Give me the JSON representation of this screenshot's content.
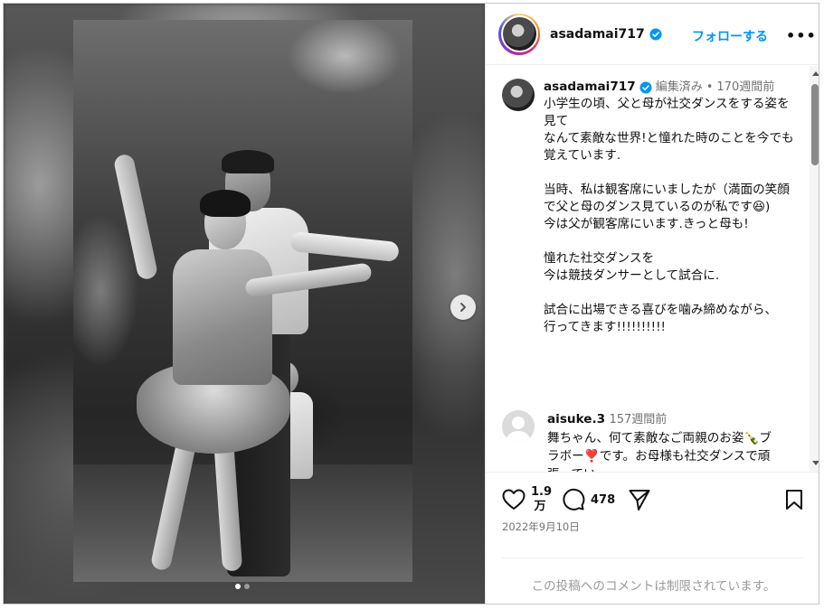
{
  "post": {
    "author": {
      "username": "asadamai717",
      "verified": true,
      "verified_icon": "verified-badge-icon",
      "verified_color": "#0095f6"
    },
    "follow_label": "フォローする",
    "more_icon": "more-horizontal-icon",
    "more_label": "•••"
  },
  "media": {
    "carousel_dots": 2,
    "active_dot": 0,
    "next_icon": "chevron-right-icon"
  },
  "caption": {
    "username": "asadamai717",
    "edited_label": "編集済み",
    "separator": "•",
    "time": "170週間前",
    "lines": [
      "小学生の頃、父と母が社交ダンスをする姿を見て",
      "なんて素敵な世界!と憧れた時のことを今でも覚えています.",
      "",
      "当時、私は観客席にいましたが（満面の笑顔で父と母のダンス見ているのが私です😆)",
      "今は父が観客席にいます.きっと母も!",
      "",
      "憧れた社交ダンスを",
      "今は競技ダンサーとして試合に.",
      "",
      "試合に出場できる喜びを噛み締めながら、",
      "行ってきます!!!!!!!!!!"
    ]
  },
  "comments": [
    {
      "username": "aisuke.3",
      "time": "157週間前",
      "text": "舞ちゃん、何て素敵なご両親のお姿🍾ブラボー❣️です。お母様も社交ダンスで頑張ってい"
    }
  ],
  "actions": {
    "likes_line1": "1.9",
    "likes_line2": "万",
    "comments_count": "478",
    "date": "2022年9月10日",
    "comments_restricted": "この投稿へのコメントは制限されています。"
  },
  "colors": {
    "accent": "#0095f6",
    "muted_text": "#737373",
    "restricted_text": "#9a9a9a"
  }
}
